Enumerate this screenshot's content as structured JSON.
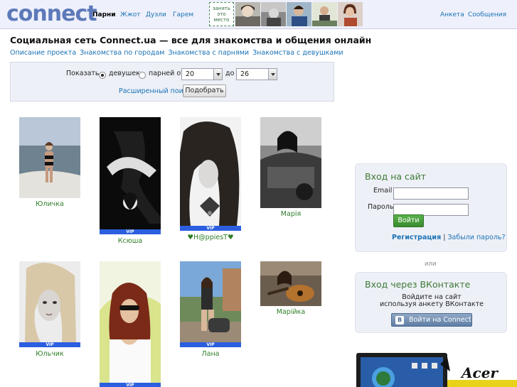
{
  "header": {
    "logo": "connect",
    "nav": [
      {
        "label": "Парни",
        "active": true
      },
      {
        "label": "Жжот",
        "active": false
      },
      {
        "label": "Дуэли",
        "active": false
      },
      {
        "label": "Гарем",
        "active": false
      }
    ],
    "slot_label": "занять это место",
    "links": [
      "Анкета",
      "Сообщения"
    ]
  },
  "page": {
    "title": "Социальная сеть Connect.ua — все для знакомства и общения онлайн",
    "sublinks": [
      "Описание проекта",
      "Знакомства по городам",
      "Знакомства с парнями",
      "Знакомства с девушками"
    ]
  },
  "filter": {
    "show_label": "Показать",
    "girls_label": "девушек",
    "guys_label": "парней от",
    "selected": "girls",
    "age_from": "20",
    "to_label": "до",
    "age_to": "26",
    "advanced_link": "Расширенный поиск",
    "pick_button": "Подобрать"
  },
  "profiles": [
    {
      "name": "Юличка",
      "vip": false
    },
    {
      "name": "Ксюша",
      "vip": true
    },
    {
      "name": "♥H@ppiesT♥",
      "vip": true
    },
    {
      "name": "Марія",
      "vip": false
    },
    {
      "name": "Юльчик",
      "vip": true
    },
    {
      "name": "",
      "vip": true
    },
    {
      "name": "Лана",
      "vip": true
    },
    {
      "name": "Марійка",
      "vip": false
    }
  ],
  "vip_label": "VIP",
  "login": {
    "title": "Вход на сайт",
    "email_label": "Email",
    "password_label": "Пароль",
    "button": "Войти",
    "register": "Регистрация",
    "separator": "|",
    "forgot": "Забыли пароль?"
  },
  "or_label": "или",
  "vk": {
    "title": "Вход через ВКонтакте",
    "text_line1": "Войдите на сайт",
    "text_line2": "используя анкету ВКонтакте",
    "button": "Войти на Connect",
    "logo_letter": "B"
  },
  "ad": {
    "brand": "Acer"
  },
  "colors": {
    "link": "#1b73b5",
    "name_green": "#2f7e28",
    "vip_blue": "#2c5ee0",
    "panel_title": "#3d7a36",
    "login_green": "#3a8a30",
    "vk_blue": "#5f7ea5"
  }
}
